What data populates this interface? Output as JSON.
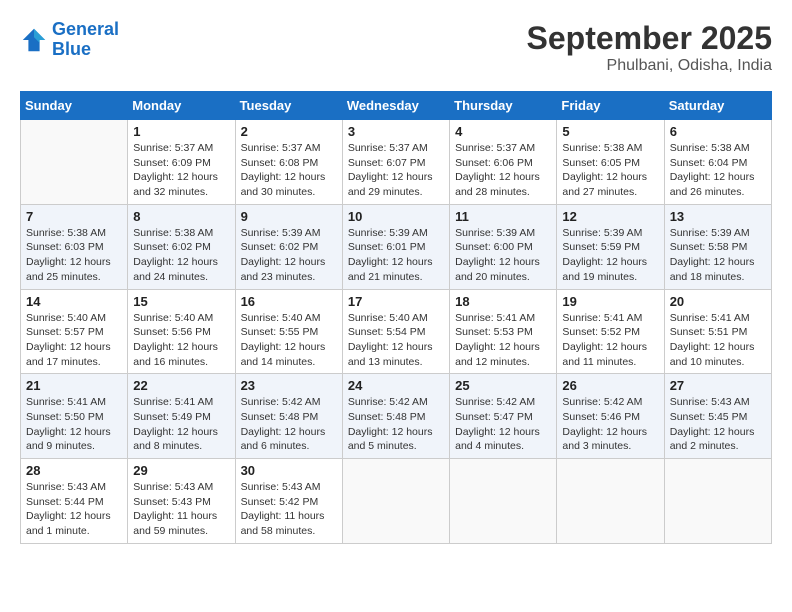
{
  "header": {
    "logo_line1": "General",
    "logo_line2": "Blue",
    "month_title": "September 2025",
    "location": "Phulbani, Odisha, India"
  },
  "weekdays": [
    "Sunday",
    "Monday",
    "Tuesday",
    "Wednesday",
    "Thursday",
    "Friday",
    "Saturday"
  ],
  "weeks": [
    [
      {
        "day": "",
        "info": ""
      },
      {
        "day": "1",
        "info": "Sunrise: 5:37 AM\nSunset: 6:09 PM\nDaylight: 12 hours\nand 32 minutes."
      },
      {
        "day": "2",
        "info": "Sunrise: 5:37 AM\nSunset: 6:08 PM\nDaylight: 12 hours\nand 30 minutes."
      },
      {
        "day": "3",
        "info": "Sunrise: 5:37 AM\nSunset: 6:07 PM\nDaylight: 12 hours\nand 29 minutes."
      },
      {
        "day": "4",
        "info": "Sunrise: 5:37 AM\nSunset: 6:06 PM\nDaylight: 12 hours\nand 28 minutes."
      },
      {
        "day": "5",
        "info": "Sunrise: 5:38 AM\nSunset: 6:05 PM\nDaylight: 12 hours\nand 27 minutes."
      },
      {
        "day": "6",
        "info": "Sunrise: 5:38 AM\nSunset: 6:04 PM\nDaylight: 12 hours\nand 26 minutes."
      }
    ],
    [
      {
        "day": "7",
        "info": "Sunrise: 5:38 AM\nSunset: 6:03 PM\nDaylight: 12 hours\nand 25 minutes."
      },
      {
        "day": "8",
        "info": "Sunrise: 5:38 AM\nSunset: 6:02 PM\nDaylight: 12 hours\nand 24 minutes."
      },
      {
        "day": "9",
        "info": "Sunrise: 5:39 AM\nSunset: 6:02 PM\nDaylight: 12 hours\nand 23 minutes."
      },
      {
        "day": "10",
        "info": "Sunrise: 5:39 AM\nSunset: 6:01 PM\nDaylight: 12 hours\nand 21 minutes."
      },
      {
        "day": "11",
        "info": "Sunrise: 5:39 AM\nSunset: 6:00 PM\nDaylight: 12 hours\nand 20 minutes."
      },
      {
        "day": "12",
        "info": "Sunrise: 5:39 AM\nSunset: 5:59 PM\nDaylight: 12 hours\nand 19 minutes."
      },
      {
        "day": "13",
        "info": "Sunrise: 5:39 AM\nSunset: 5:58 PM\nDaylight: 12 hours\nand 18 minutes."
      }
    ],
    [
      {
        "day": "14",
        "info": "Sunrise: 5:40 AM\nSunset: 5:57 PM\nDaylight: 12 hours\nand 17 minutes."
      },
      {
        "day": "15",
        "info": "Sunrise: 5:40 AM\nSunset: 5:56 PM\nDaylight: 12 hours\nand 16 minutes."
      },
      {
        "day": "16",
        "info": "Sunrise: 5:40 AM\nSunset: 5:55 PM\nDaylight: 12 hours\nand 14 minutes."
      },
      {
        "day": "17",
        "info": "Sunrise: 5:40 AM\nSunset: 5:54 PM\nDaylight: 12 hours\nand 13 minutes."
      },
      {
        "day": "18",
        "info": "Sunrise: 5:41 AM\nSunset: 5:53 PM\nDaylight: 12 hours\nand 12 minutes."
      },
      {
        "day": "19",
        "info": "Sunrise: 5:41 AM\nSunset: 5:52 PM\nDaylight: 12 hours\nand 11 minutes."
      },
      {
        "day": "20",
        "info": "Sunrise: 5:41 AM\nSunset: 5:51 PM\nDaylight: 12 hours\nand 10 minutes."
      }
    ],
    [
      {
        "day": "21",
        "info": "Sunrise: 5:41 AM\nSunset: 5:50 PM\nDaylight: 12 hours\nand 9 minutes."
      },
      {
        "day": "22",
        "info": "Sunrise: 5:41 AM\nSunset: 5:49 PM\nDaylight: 12 hours\nand 8 minutes."
      },
      {
        "day": "23",
        "info": "Sunrise: 5:42 AM\nSunset: 5:48 PM\nDaylight: 12 hours\nand 6 minutes."
      },
      {
        "day": "24",
        "info": "Sunrise: 5:42 AM\nSunset: 5:48 PM\nDaylight: 12 hours\nand 5 minutes."
      },
      {
        "day": "25",
        "info": "Sunrise: 5:42 AM\nSunset: 5:47 PM\nDaylight: 12 hours\nand 4 minutes."
      },
      {
        "day": "26",
        "info": "Sunrise: 5:42 AM\nSunset: 5:46 PM\nDaylight: 12 hours\nand 3 minutes."
      },
      {
        "day": "27",
        "info": "Sunrise: 5:43 AM\nSunset: 5:45 PM\nDaylight: 12 hours\nand 2 minutes."
      }
    ],
    [
      {
        "day": "28",
        "info": "Sunrise: 5:43 AM\nSunset: 5:44 PM\nDaylight: 12 hours\nand 1 minute."
      },
      {
        "day": "29",
        "info": "Sunrise: 5:43 AM\nSunset: 5:43 PM\nDaylight: 11 hours\nand 59 minutes."
      },
      {
        "day": "30",
        "info": "Sunrise: 5:43 AM\nSunset: 5:42 PM\nDaylight: 11 hours\nand 58 minutes."
      },
      {
        "day": "",
        "info": ""
      },
      {
        "day": "",
        "info": ""
      },
      {
        "day": "",
        "info": ""
      },
      {
        "day": "",
        "info": ""
      }
    ]
  ]
}
